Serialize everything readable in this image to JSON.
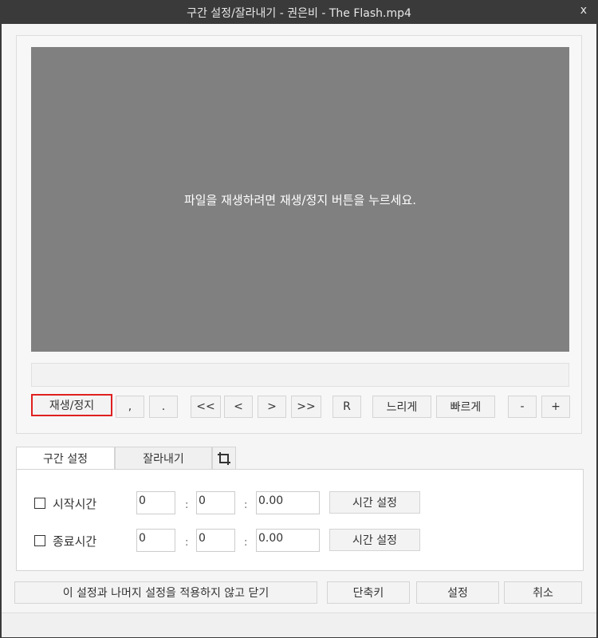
{
  "window": {
    "title": "구간 설정/잘라내기 - 권은비 - The Flash.mp4",
    "close_label": "x"
  },
  "player": {
    "message": "파일을 재생하려면 재생/정지 버튼을 누르세요.",
    "controls": {
      "play_stop": "재생/정지",
      "comma": ",",
      "period": ".",
      "rewind_fast": "<<",
      "rewind": "<",
      "forward": ">",
      "forward_fast": ">>",
      "repeat": "R",
      "slower": "느리게",
      "faster": "빠르게",
      "minus": "-",
      "plus": "+"
    }
  },
  "tabs": [
    {
      "label": "구간 설정",
      "selected": true
    },
    {
      "label": "잘라내기",
      "selected": false
    },
    {
      "icon": "crop-icon"
    }
  ],
  "range": {
    "start": {
      "label": "시작시간",
      "checked": false,
      "hours": "0",
      "minutes": "0",
      "seconds": "0.00",
      "set_label": "시간 설정"
    },
    "end": {
      "label": "종료시간",
      "checked": false,
      "hours": "0",
      "minutes": "0",
      "seconds": "0.00",
      "set_label": "시간 설정"
    },
    "colon": ":"
  },
  "footer": {
    "close_without_apply": "이 설정과 나머지 설정을 적용하지 않고 닫기",
    "shortcuts": "단축키",
    "settings": "설정",
    "cancel": "취소"
  }
}
